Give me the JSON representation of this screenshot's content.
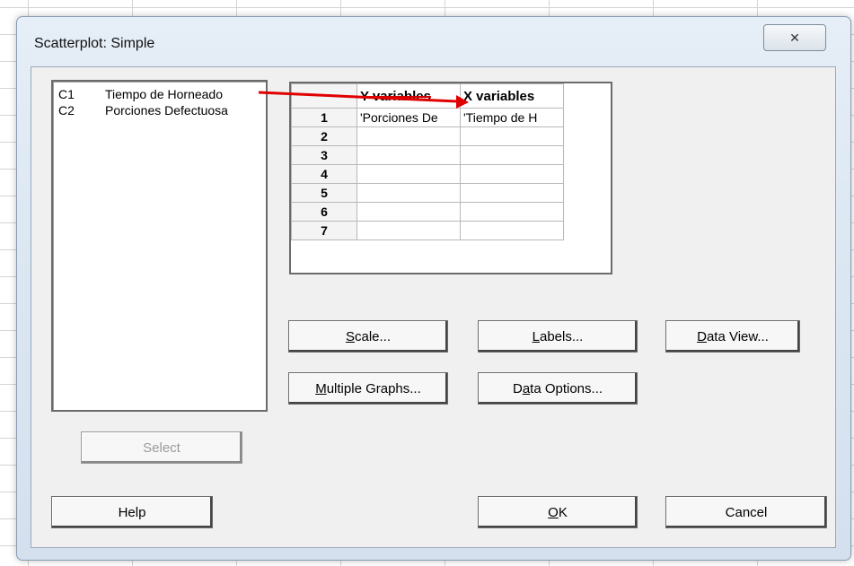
{
  "dialog": {
    "title": "Scatterplot: Simple",
    "close_glyph": "✕"
  },
  "variables": [
    {
      "id": "C1",
      "name": "Tiempo de Horneado"
    },
    {
      "id": "C2",
      "name": "Porciones Defectuosa"
    }
  ],
  "grid": {
    "headers": {
      "y": "Y variables",
      "x": "X variables"
    },
    "rows": [
      {
        "n": "1",
        "y": "'Porciones De",
        "x": "'Tiempo de H"
      },
      {
        "n": "2",
        "y": "",
        "x": ""
      },
      {
        "n": "3",
        "y": "",
        "x": ""
      },
      {
        "n": "4",
        "y": "",
        "x": ""
      },
      {
        "n": "5",
        "y": "",
        "x": ""
      },
      {
        "n": "6",
        "y": "",
        "x": ""
      },
      {
        "n": "7",
        "y": "",
        "x": ""
      }
    ]
  },
  "buttons": {
    "scale": {
      "pre": "",
      "key": "S",
      "post": "cale..."
    },
    "labels": {
      "pre": "",
      "key": "L",
      "post": "abels..."
    },
    "data_view": {
      "pre": "",
      "key": "D",
      "post": "ata View..."
    },
    "multiple_graphs": {
      "pre": "",
      "key": "M",
      "post": "ultiple Graphs..."
    },
    "data_options": {
      "pre": "D",
      "key": "a",
      "post": "ta Options..."
    },
    "select": "Select",
    "help": "Help",
    "ok": {
      "pre": "",
      "key": "O",
      "post": "K"
    },
    "cancel": "Cancel"
  },
  "annotation_color": "#e00000"
}
